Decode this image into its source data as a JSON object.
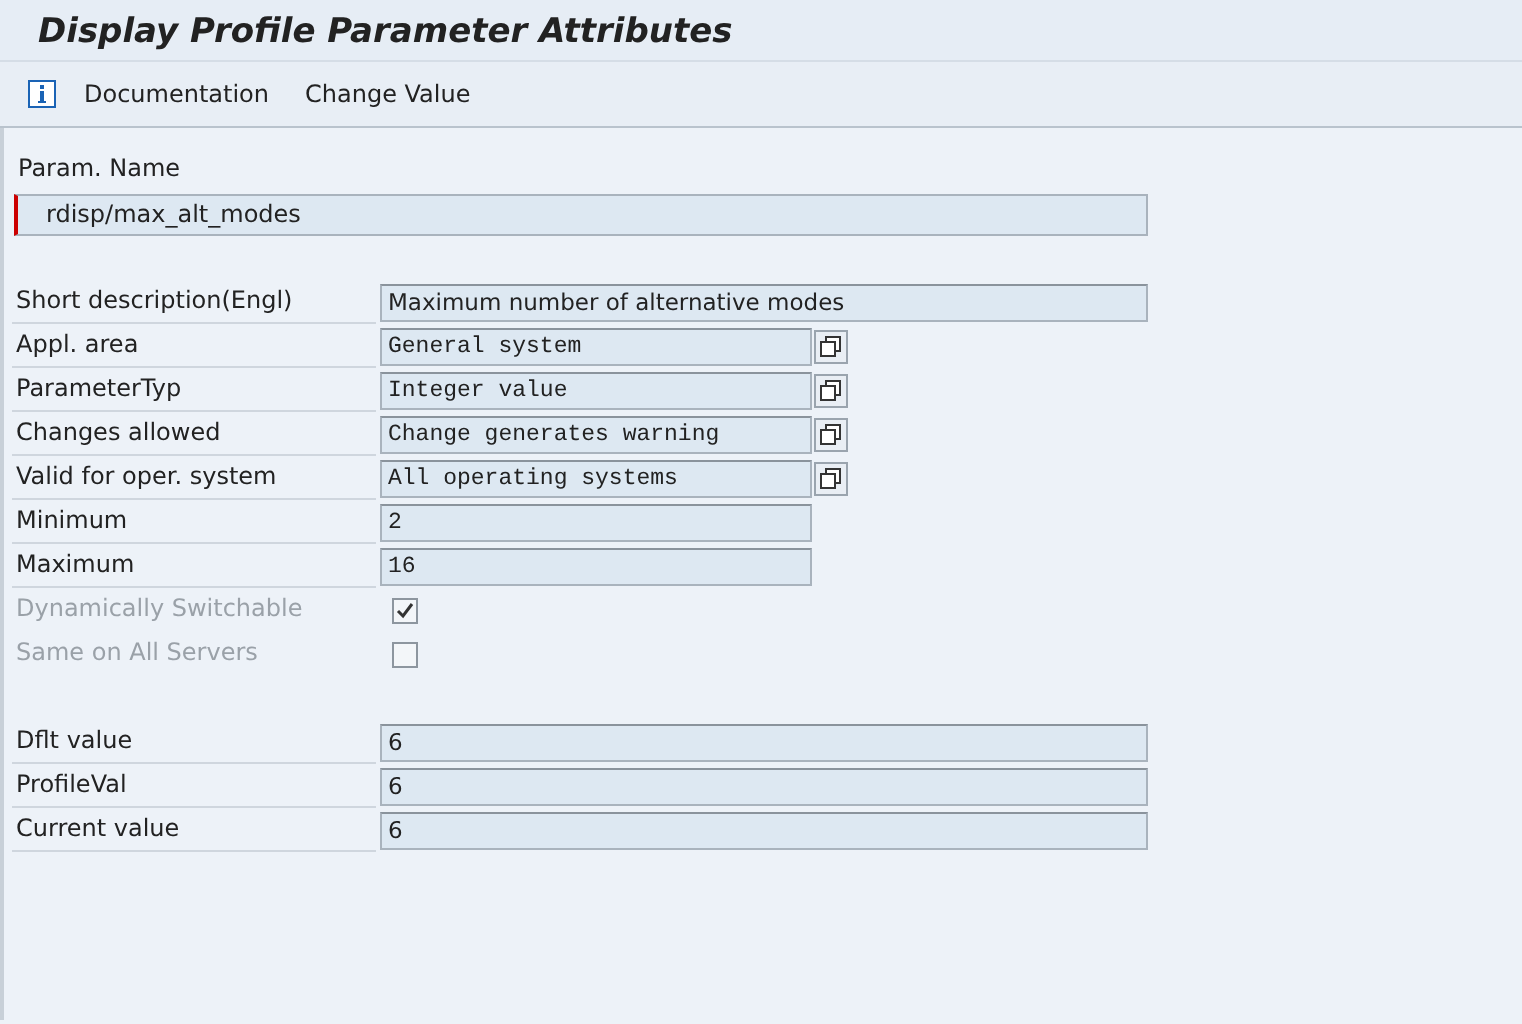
{
  "window": {
    "title": "Display Profile Parameter Attributes"
  },
  "toolbar": {
    "buttons": [
      "Documentation",
      "Change Value"
    ]
  },
  "param_name": {
    "label": "Param. Name",
    "value": "rdisp/max_alt_modes"
  },
  "attributes": [
    {
      "kind": "text",
      "label": "Short description(Engl)",
      "value": "Maximum number of alternative modes"
    },
    {
      "kind": "select",
      "label": "Appl. area",
      "value": "General system"
    },
    {
      "kind": "select",
      "label": "ParameterTyp",
      "value": "Integer value"
    },
    {
      "kind": "select",
      "label": "Changes allowed",
      "value": "Change generates warning"
    },
    {
      "kind": "select",
      "label": "Valid for oper. system",
      "value": "All operating systems"
    },
    {
      "kind": "number",
      "label": "Minimum",
      "value": "2"
    },
    {
      "kind": "number",
      "label": "Maximum",
      "value": "16"
    },
    {
      "kind": "checkbox",
      "label": "Dynamically Switchable",
      "checked": true,
      "disabled": true
    },
    {
      "kind": "checkbox",
      "label": "Same on All Servers",
      "checked": false,
      "disabled": true
    }
  ],
  "values": [
    {
      "label": "Dflt value",
      "value": "6"
    },
    {
      "label": "ProfileVal",
      "value": "6"
    },
    {
      "label": "Current value",
      "value": "6"
    }
  ]
}
